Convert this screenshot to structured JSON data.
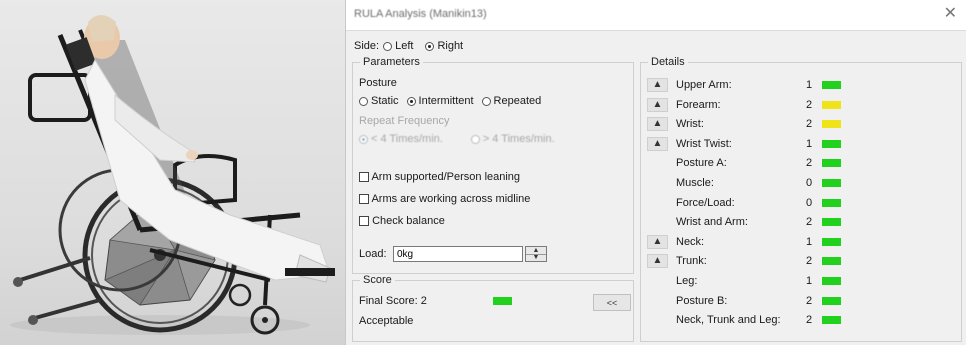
{
  "window": {
    "title": "RULA Analysis (Manikin13)",
    "close_glyph": "✕"
  },
  "side": {
    "label": "Side:",
    "options": [
      {
        "label": "Left",
        "checked": false
      },
      {
        "label": "Right",
        "checked": true
      }
    ]
  },
  "parameters": {
    "title": "Parameters",
    "posture_label": "Posture",
    "posture_options": [
      {
        "label": "Static",
        "checked": false
      },
      {
        "label": "Intermittent",
        "checked": true
      },
      {
        "label": "Repeated",
        "checked": false
      }
    ],
    "repeat_frequency_label": "Repeat Frequency",
    "frequency_options": [
      {
        "label": "< 4 Times/min.",
        "checked": true
      },
      {
        "label": "> 4 Times/min.",
        "checked": false
      }
    ],
    "checkboxes": [
      {
        "label": "Arm supported/Person leaning",
        "checked": false
      },
      {
        "label": "Arms are working across midline",
        "checked": false
      },
      {
        "label": "Check balance",
        "checked": false
      }
    ],
    "load_label": "Load:",
    "load_value": "0kg"
  },
  "score": {
    "title": "Score",
    "final_score_label": "Final Score: 2",
    "status": "Acceptable",
    "status_color": "#21d11e",
    "toggle_label": "<<"
  },
  "details": {
    "title": "Details",
    "rows": [
      {
        "label": "Upper Arm:",
        "value": "1",
        "color": "green",
        "expand": true
      },
      {
        "label": "Forearm:",
        "value": "2",
        "color": "yellow",
        "expand": true
      },
      {
        "label": "Wrist:",
        "value": "2",
        "color": "yellow",
        "expand": true
      },
      {
        "label": "Wrist Twist:",
        "value": "1",
        "color": "green",
        "expand": true
      },
      {
        "label": "Posture A:",
        "value": "2",
        "color": "green",
        "expand": false
      },
      {
        "label": "Muscle:",
        "value": "0",
        "color": "green",
        "expand": false
      },
      {
        "label": "Force/Load:",
        "value": "0",
        "color": "green",
        "expand": false
      },
      {
        "label": "Wrist and Arm:",
        "value": "2",
        "color": "green",
        "expand": false
      },
      {
        "label": "Neck:",
        "value": "1",
        "color": "green",
        "expand": true
      },
      {
        "label": "Trunk:",
        "value": "2",
        "color": "green",
        "expand": true
      },
      {
        "label": "Leg:",
        "value": "1",
        "color": "green",
        "expand": false
      },
      {
        "label": "Posture B:",
        "value": "2",
        "color": "green",
        "expand": false
      },
      {
        "label": "Neck, Trunk and Leg:",
        "value": "2",
        "color": "green",
        "expand": false
      }
    ],
    "expand_glyph": "▲"
  },
  "colors": {
    "green": "#21d11e",
    "yellow": "#efe41a"
  }
}
